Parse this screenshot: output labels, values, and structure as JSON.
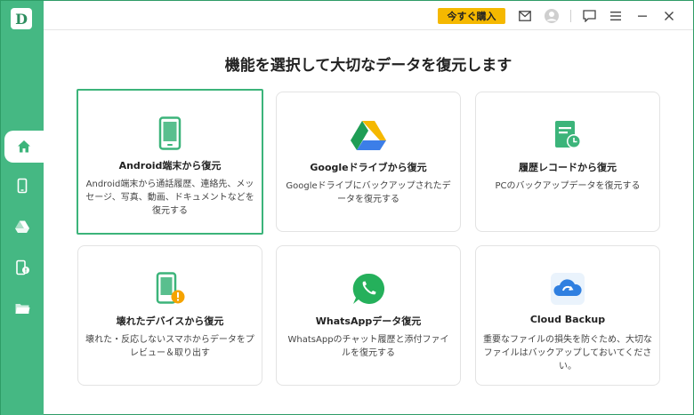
{
  "app": {
    "logo_letter": "D"
  },
  "titlebar": {
    "buy_label": "今すぐ購入",
    "accent": "#f5b800"
  },
  "sidebar": {
    "color": "#45b883",
    "items": [
      {
        "icon": "home-icon",
        "active": true
      },
      {
        "icon": "phone-icon",
        "active": false
      },
      {
        "icon": "google-drive-icon",
        "active": false
      },
      {
        "icon": "history-icon",
        "active": false
      },
      {
        "icon": "folder-icon",
        "active": false
      }
    ]
  },
  "main": {
    "title": "機能を選択して大切なデータを復元します",
    "cards": [
      {
        "title": "Android端末から復元",
        "desc": "Android端末から通話履歴、連絡先、メッセージ、写真、動画、ドキュメントなどを復元する",
        "icon": "android-phone-icon"
      },
      {
        "title": "Googleドライブから復元",
        "desc": "Googleドライブにバックアップされたデータを復元する",
        "icon": "google-drive-icon"
      },
      {
        "title": "履歴レコードから復元",
        "desc": "PCのバックアップデータを復元する",
        "icon": "history-record-icon"
      },
      {
        "title": "壊れたデバイスから復元",
        "desc": "壊れた・反応しないスマホからデータをプレビュー＆取り出す",
        "icon": "broken-device-icon"
      },
      {
        "title": "WhatsAppデータ復元",
        "desc": "WhatsAppのチャット履歴と添付ファイルを復元する",
        "icon": "whatsapp-icon"
      },
      {
        "title": "Cloud Backup",
        "desc": "重要なファイルの損失を防ぐため、大切なファイルはバックアップしておいてください。",
        "icon": "cloud-backup-icon"
      }
    ]
  }
}
